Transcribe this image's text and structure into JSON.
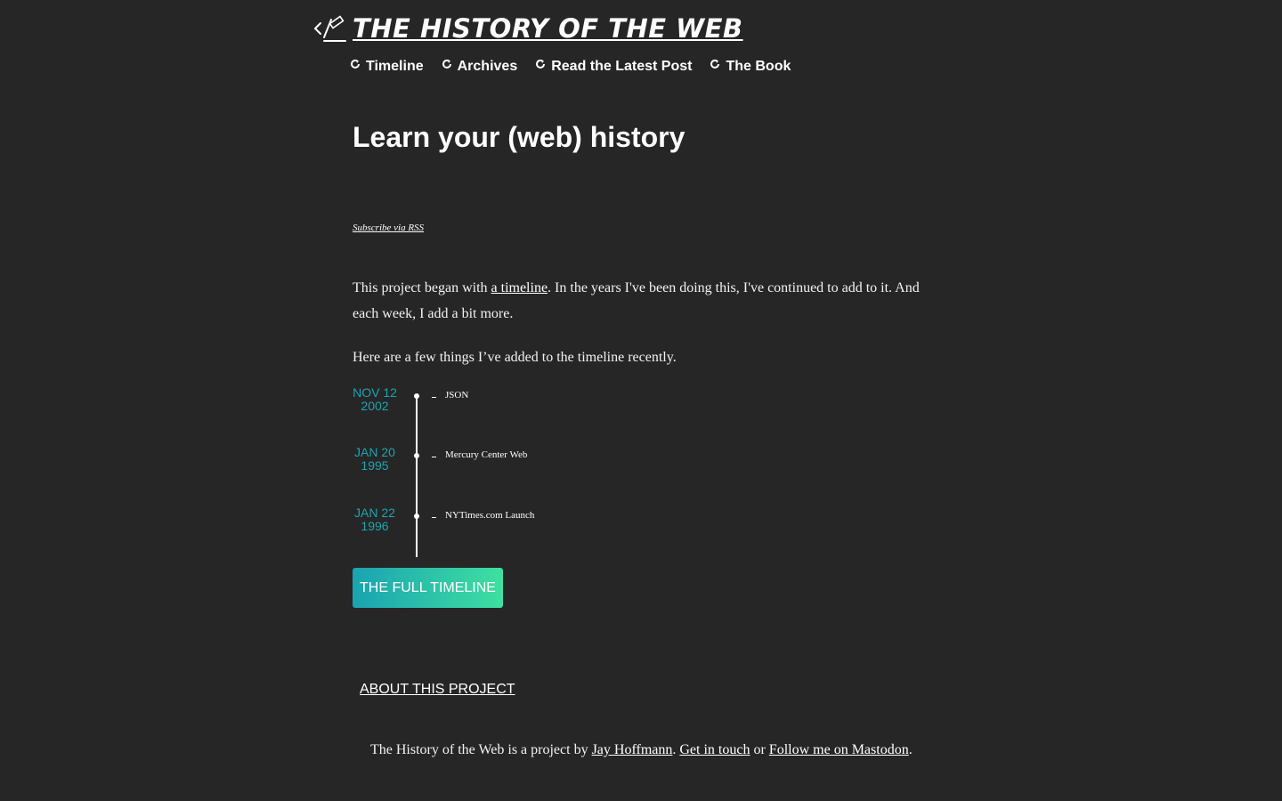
{
  "site": {
    "title": "THE HISTORY OF THE WEB",
    "logo_icon": "code-wand-icon"
  },
  "nav": {
    "items": [
      {
        "label": "Timeline",
        "icon": "refresh-icon"
      },
      {
        "label": "Archives",
        "icon": "refresh-icon"
      },
      {
        "label": "Read the Latest Post",
        "icon": "refresh-icon"
      },
      {
        "label": "The Book",
        "icon": "refresh-icon"
      }
    ]
  },
  "main": {
    "title": "Learn your (web) history",
    "rss_label": "Subscribe via RSS",
    "intro": {
      "p1_before": "This project began with ",
      "p1_link": "a timeline",
      "p1_after": ". In the years I've been doing this, I've continued to add to it. And each week, I add a bit more.",
      "p2": "Here are a few things I’ve added to the timeline recently."
    },
    "timeline": [
      {
        "date_line1": "NOV 12",
        "date_line2": "2002",
        "label": "JSON"
      },
      {
        "date_line1": "JAN 20",
        "date_line2": "1995",
        "label": "Mercury Center Web"
      },
      {
        "date_line1": "JAN 22",
        "date_line2": "1996",
        "label": "NYTimes.com Launch"
      }
    ],
    "full_timeline_button": "THE FULL TIMELINE",
    "about_link": "ABOUT THIS PROJECT"
  },
  "footer": {
    "text1": "The History of the Web is a project by ",
    "author_link": "Jay Hoffmann",
    "sep1": ". ",
    "contact_link": "Get in touch",
    "sep2": " or ",
    "mastodon_link": "Follow me on Mastodon",
    "end": "."
  },
  "colors": {
    "background": "#262626",
    "accent_teal": "#1ba5b0",
    "button_gradient_start": "#1aa3b1",
    "button_gradient_end": "#3ee0a0"
  }
}
